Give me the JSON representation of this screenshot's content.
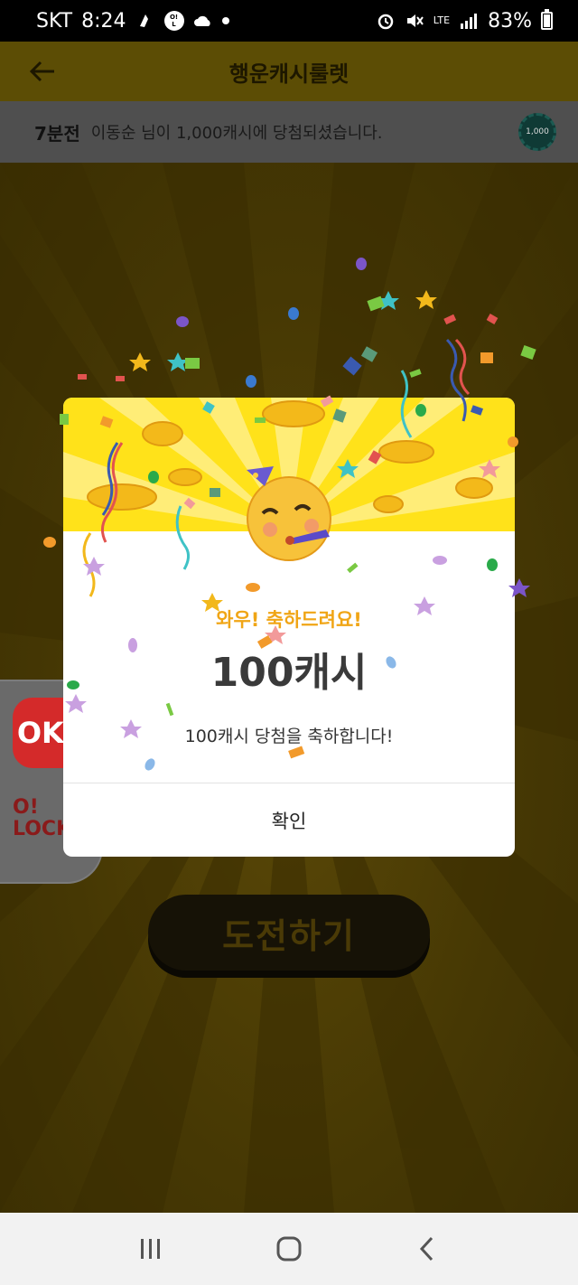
{
  "status_bar": {
    "carrier": "SKT",
    "time": "8:24",
    "network": "LTE",
    "battery": "83%",
    "olock_badge": "O! LOCK"
  },
  "app_bar": {
    "title": "행운캐시룰렛"
  },
  "ticker": {
    "time_ago": "7분전",
    "message": "이동순 님이 1,000캐시에 당첨되셨습니다.",
    "coin_label": "1,000"
  },
  "main": {
    "challenge_button": "도전하기"
  },
  "side_dock": {
    "ok_app_label": "OK",
    "olock_line1": "O!",
    "olock_line2": "LOCK"
  },
  "modal": {
    "subtitle": "와우! 축하드려요!",
    "amount": "100캐시",
    "message": "100캐시 당첨을 축하합니다!",
    "confirm": "확인"
  },
  "colors": {
    "accent_yellow": "#ffe21a",
    "subtitle_orange": "#f0a515",
    "ok_red": "#d42a2a"
  }
}
